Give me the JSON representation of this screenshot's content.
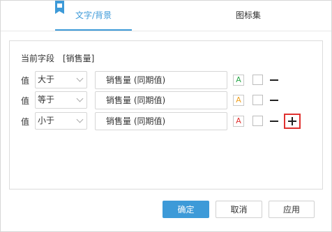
{
  "tabs": [
    {
      "label": "文字/背景",
      "active": true
    },
    {
      "label": "图标集",
      "active": false
    }
  ],
  "current_field": {
    "label": "当前字段",
    "value": "[销售量]"
  },
  "rows": [
    {
      "label": "值",
      "operator": "大于",
      "value": "销售量 (同期值)",
      "color_glyph": "A",
      "color": "#2aa84a"
    },
    {
      "label": "值",
      "operator": "等于",
      "value": "销售量 (同期值)",
      "color_glyph": "A",
      "color": "#f0a020"
    },
    {
      "label": "值",
      "operator": "小于",
      "value": "销售量 (同期值)",
      "color_glyph": "A",
      "color": "#e0312f"
    }
  ],
  "footer": {
    "ok_label": "确定",
    "cancel_label": "取消",
    "apply_label": "应用"
  },
  "colors": {
    "accent": "#3d9ad8",
    "highlight_border": "#e0312f"
  },
  "icons": {
    "tab_marker": "tab-marker-icon",
    "remove": "minus-icon",
    "add": "plus-icon",
    "dropdown": "chevron-down-icon"
  }
}
